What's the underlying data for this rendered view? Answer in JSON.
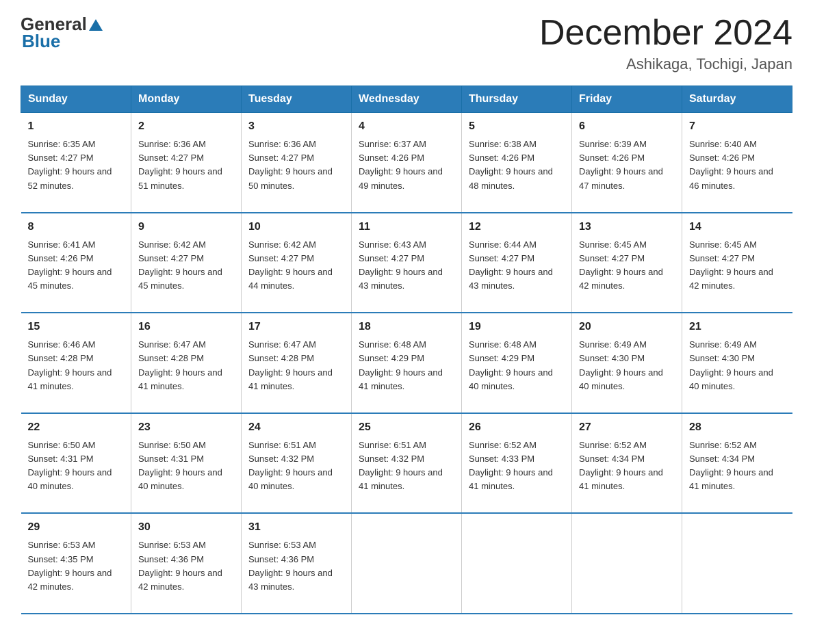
{
  "logo": {
    "text_general": "General",
    "triangle": "▲",
    "text_blue": "Blue"
  },
  "header": {
    "month_title": "December 2024",
    "location": "Ashikaga, Tochigi, Japan"
  },
  "weekdays": [
    "Sunday",
    "Monday",
    "Tuesday",
    "Wednesday",
    "Thursday",
    "Friday",
    "Saturday"
  ],
  "weeks": [
    [
      {
        "day": "1",
        "sunrise": "Sunrise: 6:35 AM",
        "sunset": "Sunset: 4:27 PM",
        "daylight": "Daylight: 9 hours and 52 minutes."
      },
      {
        "day": "2",
        "sunrise": "Sunrise: 6:36 AM",
        "sunset": "Sunset: 4:27 PM",
        "daylight": "Daylight: 9 hours and 51 minutes."
      },
      {
        "day": "3",
        "sunrise": "Sunrise: 6:36 AM",
        "sunset": "Sunset: 4:27 PM",
        "daylight": "Daylight: 9 hours and 50 minutes."
      },
      {
        "day": "4",
        "sunrise": "Sunrise: 6:37 AM",
        "sunset": "Sunset: 4:26 PM",
        "daylight": "Daylight: 9 hours and 49 minutes."
      },
      {
        "day": "5",
        "sunrise": "Sunrise: 6:38 AM",
        "sunset": "Sunset: 4:26 PM",
        "daylight": "Daylight: 9 hours and 48 minutes."
      },
      {
        "day": "6",
        "sunrise": "Sunrise: 6:39 AM",
        "sunset": "Sunset: 4:26 PM",
        "daylight": "Daylight: 9 hours and 47 minutes."
      },
      {
        "day": "7",
        "sunrise": "Sunrise: 6:40 AM",
        "sunset": "Sunset: 4:26 PM",
        "daylight": "Daylight: 9 hours and 46 minutes."
      }
    ],
    [
      {
        "day": "8",
        "sunrise": "Sunrise: 6:41 AM",
        "sunset": "Sunset: 4:26 PM",
        "daylight": "Daylight: 9 hours and 45 minutes."
      },
      {
        "day": "9",
        "sunrise": "Sunrise: 6:42 AM",
        "sunset": "Sunset: 4:27 PM",
        "daylight": "Daylight: 9 hours and 45 minutes."
      },
      {
        "day": "10",
        "sunrise": "Sunrise: 6:42 AM",
        "sunset": "Sunset: 4:27 PM",
        "daylight": "Daylight: 9 hours and 44 minutes."
      },
      {
        "day": "11",
        "sunrise": "Sunrise: 6:43 AM",
        "sunset": "Sunset: 4:27 PM",
        "daylight": "Daylight: 9 hours and 43 minutes."
      },
      {
        "day": "12",
        "sunrise": "Sunrise: 6:44 AM",
        "sunset": "Sunset: 4:27 PM",
        "daylight": "Daylight: 9 hours and 43 minutes."
      },
      {
        "day": "13",
        "sunrise": "Sunrise: 6:45 AM",
        "sunset": "Sunset: 4:27 PM",
        "daylight": "Daylight: 9 hours and 42 minutes."
      },
      {
        "day": "14",
        "sunrise": "Sunrise: 6:45 AM",
        "sunset": "Sunset: 4:27 PM",
        "daylight": "Daylight: 9 hours and 42 minutes."
      }
    ],
    [
      {
        "day": "15",
        "sunrise": "Sunrise: 6:46 AM",
        "sunset": "Sunset: 4:28 PM",
        "daylight": "Daylight: 9 hours and 41 minutes."
      },
      {
        "day": "16",
        "sunrise": "Sunrise: 6:47 AM",
        "sunset": "Sunset: 4:28 PM",
        "daylight": "Daylight: 9 hours and 41 minutes."
      },
      {
        "day": "17",
        "sunrise": "Sunrise: 6:47 AM",
        "sunset": "Sunset: 4:28 PM",
        "daylight": "Daylight: 9 hours and 41 minutes."
      },
      {
        "day": "18",
        "sunrise": "Sunrise: 6:48 AM",
        "sunset": "Sunset: 4:29 PM",
        "daylight": "Daylight: 9 hours and 41 minutes."
      },
      {
        "day": "19",
        "sunrise": "Sunrise: 6:48 AM",
        "sunset": "Sunset: 4:29 PM",
        "daylight": "Daylight: 9 hours and 40 minutes."
      },
      {
        "day": "20",
        "sunrise": "Sunrise: 6:49 AM",
        "sunset": "Sunset: 4:30 PM",
        "daylight": "Daylight: 9 hours and 40 minutes."
      },
      {
        "day": "21",
        "sunrise": "Sunrise: 6:49 AM",
        "sunset": "Sunset: 4:30 PM",
        "daylight": "Daylight: 9 hours and 40 minutes."
      }
    ],
    [
      {
        "day": "22",
        "sunrise": "Sunrise: 6:50 AM",
        "sunset": "Sunset: 4:31 PM",
        "daylight": "Daylight: 9 hours and 40 minutes."
      },
      {
        "day": "23",
        "sunrise": "Sunrise: 6:50 AM",
        "sunset": "Sunset: 4:31 PM",
        "daylight": "Daylight: 9 hours and 40 minutes."
      },
      {
        "day": "24",
        "sunrise": "Sunrise: 6:51 AM",
        "sunset": "Sunset: 4:32 PM",
        "daylight": "Daylight: 9 hours and 40 minutes."
      },
      {
        "day": "25",
        "sunrise": "Sunrise: 6:51 AM",
        "sunset": "Sunset: 4:32 PM",
        "daylight": "Daylight: 9 hours and 41 minutes."
      },
      {
        "day": "26",
        "sunrise": "Sunrise: 6:52 AM",
        "sunset": "Sunset: 4:33 PM",
        "daylight": "Daylight: 9 hours and 41 minutes."
      },
      {
        "day": "27",
        "sunrise": "Sunrise: 6:52 AM",
        "sunset": "Sunset: 4:34 PM",
        "daylight": "Daylight: 9 hours and 41 minutes."
      },
      {
        "day": "28",
        "sunrise": "Sunrise: 6:52 AM",
        "sunset": "Sunset: 4:34 PM",
        "daylight": "Daylight: 9 hours and 41 minutes."
      }
    ],
    [
      {
        "day": "29",
        "sunrise": "Sunrise: 6:53 AM",
        "sunset": "Sunset: 4:35 PM",
        "daylight": "Daylight: 9 hours and 42 minutes."
      },
      {
        "day": "30",
        "sunrise": "Sunrise: 6:53 AM",
        "sunset": "Sunset: 4:36 PM",
        "daylight": "Daylight: 9 hours and 42 minutes."
      },
      {
        "day": "31",
        "sunrise": "Sunrise: 6:53 AM",
        "sunset": "Sunset: 4:36 PM",
        "daylight": "Daylight: 9 hours and 43 minutes."
      },
      null,
      null,
      null,
      null
    ]
  ]
}
